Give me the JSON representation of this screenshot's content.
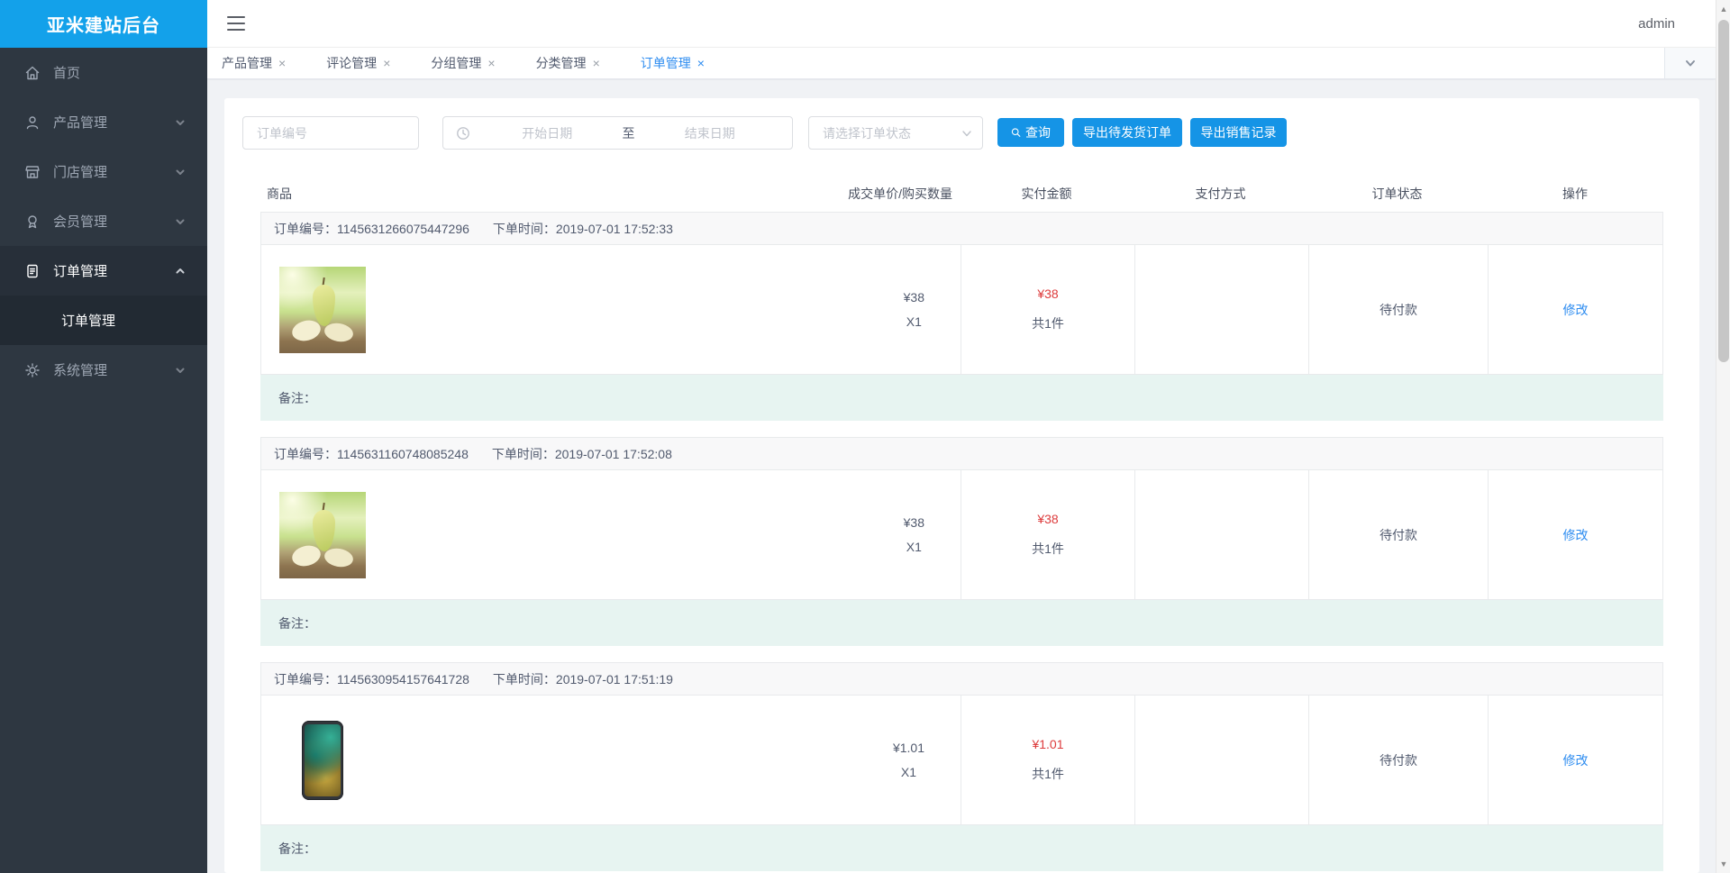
{
  "app": {
    "title": "亚米建站后台",
    "user": "admin"
  },
  "sidebar": {
    "items": [
      {
        "label": "首页",
        "icon": "home"
      },
      {
        "label": "产品管理",
        "icon": "user"
      },
      {
        "label": "门店管理",
        "icon": "shop"
      },
      {
        "label": "会员管理",
        "icon": "member"
      },
      {
        "label": "订单管理",
        "icon": "order-doc"
      },
      {
        "label": "系统管理",
        "icon": "gear"
      }
    ],
    "submenu": {
      "label": "订单管理"
    }
  },
  "tabs": {
    "close": "×",
    "items": [
      {
        "label": "产品管理"
      },
      {
        "label": "评论管理"
      },
      {
        "label": "分组管理"
      },
      {
        "label": "分类管理"
      },
      {
        "label": "订单管理"
      }
    ]
  },
  "filters": {
    "order_no_placeholder": "订单编号",
    "start_date_placeholder": "开始日期",
    "date_separator": "至",
    "end_date_placeholder": "结束日期",
    "status_placeholder": "请选择订单状态",
    "search_label": "查询",
    "export_pending_label": "导出待发货订单",
    "export_sales_label": "导出销售记录"
  },
  "table": {
    "headers": [
      "商品",
      "成交单价/购买数量",
      "实付金额",
      "支付方式",
      "订单状态",
      "操作"
    ]
  },
  "labels": {
    "order_no": "订单编号：",
    "order_time": "下单时间：",
    "remark": "备注："
  },
  "orders": [
    {
      "number": "1145631266075447296",
      "time": "2019-07-01 17:52:33",
      "product_image": "pear",
      "unit_price": "¥38",
      "quantity": "X1",
      "paid_amount": "¥38",
      "piece_count": "共1件",
      "payment_method": "",
      "status": "待付款",
      "action": "修改"
    },
    {
      "number": "1145631160748085248",
      "time": "2019-07-01 17:52:08",
      "product_image": "pear",
      "unit_price": "¥38",
      "quantity": "X1",
      "paid_amount": "¥38",
      "piece_count": "共1件",
      "payment_method": "",
      "status": "待付款",
      "action": "修改"
    },
    {
      "number": "1145630954157641728",
      "time": "2019-07-01 17:51:19",
      "product_image": "iphone",
      "unit_price": "¥1.01",
      "quantity": "X1",
      "paid_amount": "¥1.01",
      "piece_count": "共1件",
      "payment_method": "",
      "status": "待付款",
      "action": "修改"
    }
  ],
  "colors": {
    "logo_bg": "#13a1ea",
    "primary_button": "#1594e6",
    "active_tab": "#2d8cf0",
    "link": "#2d8cf0",
    "price_red": "#dd3b3c",
    "remark_bg": "#e7f4f1",
    "sidebar_bg": "#2e3741",
    "content_bg": "#f0f2f5"
  }
}
